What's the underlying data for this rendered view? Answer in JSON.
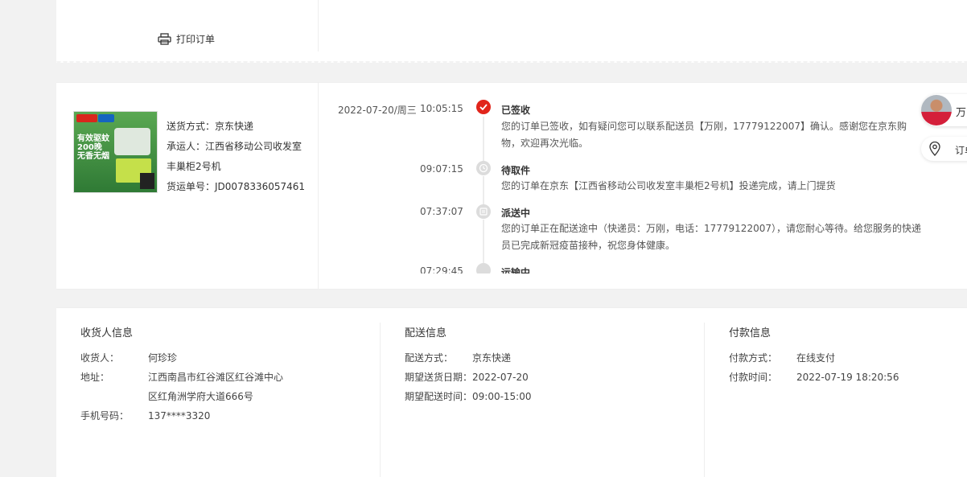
{
  "print": {
    "label": "打印订单",
    "icon": "printer-icon"
  },
  "product": {
    "image_alt": "有效驱蚊 200晚 无香无烟"
  },
  "shipping": {
    "method_label": "送货方式：",
    "method_value": "京东快递",
    "carrier_label": "承运人：",
    "carrier_value_line1": "江西省移动公司收发室",
    "carrier_value_line2": "丰巢柜2号机",
    "tracking_label": "货运单号：",
    "tracking_value": "JD0078336057461"
  },
  "timeline": [
    {
      "date": "2022-07-20/周三",
      "time": "10:05:15",
      "status": "已签收",
      "desc": "您的订单已签收，如有疑问您可以联系配送员【万刚，17779122007】确认。感谢您在京东购物，欢迎再次光临。",
      "icon": "check-icon",
      "active": true
    },
    {
      "date": "",
      "time": "09:07:15",
      "status": "待取件",
      "desc": "您的订单在京东【江西省移动公司收发室丰巢柜2号机】投递完成，请上门提货",
      "icon": "clock-icon",
      "active": false
    },
    {
      "date": "",
      "time": "07:37:07",
      "status": "派送中",
      "desc": "您的订单正在配送途中（快递员：万刚，电话：17779122007），请您耐心等待。给您服务的快递员已完成新冠疫苗接种，祝您身体健康。",
      "icon": "courier-icon",
      "active": false
    },
    {
      "date": "",
      "time": "07:29:45",
      "status": "运输中",
      "desc": "",
      "icon": "truck-icon",
      "active": false
    }
  ],
  "side": {
    "courier_name": "万刚",
    "track_label": "订单"
  },
  "receiver": {
    "title": "收货人信息",
    "name_label": "收货人：",
    "name_value": "何珍珍",
    "address_label": "地址：",
    "address_line1": "江西南昌市红谷滩区红谷滩中心",
    "address_line2": "区红角洲学府大道666号",
    "phone_label": "手机号码：",
    "phone_value": "137****3320"
  },
  "delivery": {
    "title": "配送信息",
    "method_label": "配送方式：",
    "method_value": "京东快递",
    "date_label": "期望送货日期：",
    "date_value": "2022-07-20",
    "time_label": "期望配送时间：",
    "time_value": "09:00-15:00"
  },
  "payment": {
    "title": "付款信息",
    "method_label": "付款方式：",
    "method_value": "在线支付",
    "time_label": "付款时间：",
    "time_value": "2022-07-19 18:20:56"
  },
  "colors": {
    "accent": "#e1251b",
    "inactive_dot": "#dcdcdc"
  }
}
